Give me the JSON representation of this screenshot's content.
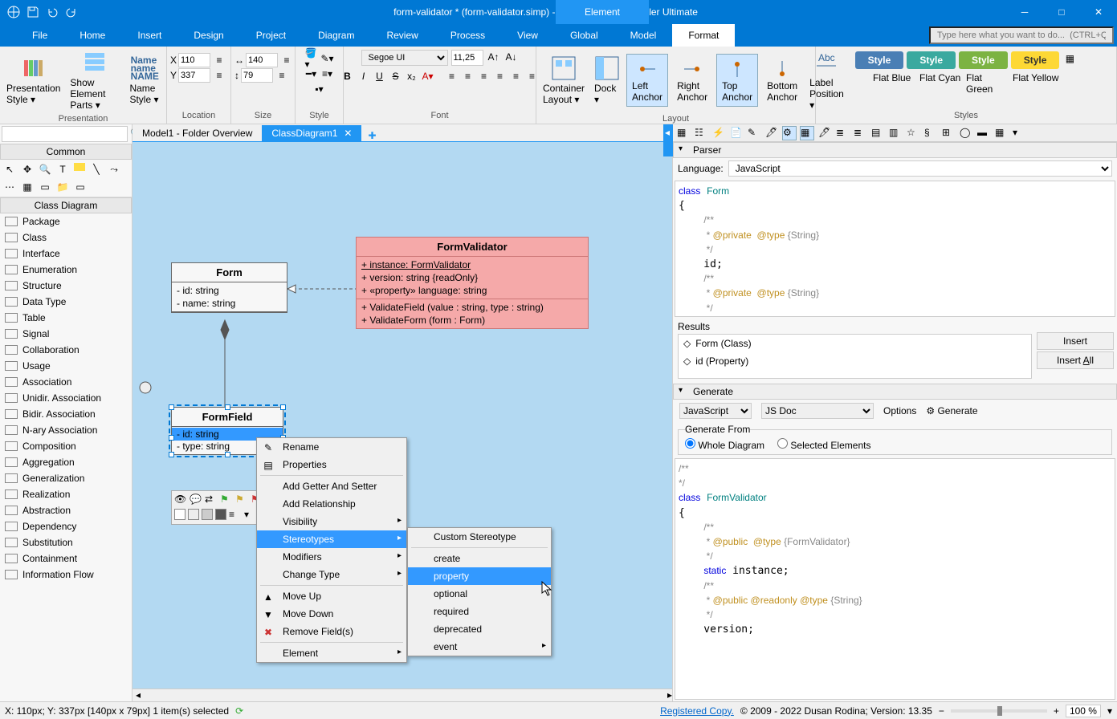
{
  "titlebar": {
    "title": "form-validator * (form-validator.simp) - Software Ideas Modeler Ultimate",
    "element_tab": "Element"
  },
  "menu": {
    "items": [
      "File",
      "Home",
      "Insert",
      "Design",
      "Project",
      "Diagram",
      "Review",
      "Process",
      "View",
      "Global",
      "Model",
      "Format"
    ],
    "active": 11,
    "search_placeholder": "Type here what you want to do...  (CTRL+Q)"
  },
  "ribbon": {
    "presentation": {
      "style": "Presentation Style ▾",
      "show": "Show Element Parts ▾",
      "name": "Name Style ▾",
      "label": "Presentation"
    },
    "location": {
      "x": "110",
      "y": "337",
      "label": "Location"
    },
    "size": {
      "w": "140",
      "h": "79",
      "label": "Size"
    },
    "style_label": "Style",
    "font": {
      "name": "Segoe UI",
      "size": "11,25",
      "bold": "B",
      "italic": "I",
      "underline": "U",
      "strike": "S",
      "label": "Font"
    },
    "layout": {
      "container": "Container Layout ▾",
      "dock": "Dock ▾",
      "left": "Left Anchor",
      "right": "Right Anchor",
      "top": "Top Anchor",
      "bottom": "Bottom Anchor",
      "labelpos": "Label Position ▾",
      "label": "Layout"
    },
    "styles": {
      "s1": "Style",
      "s2": "Style",
      "s3": "Style",
      "s4": "Style",
      "flat1": "Flat Blue",
      "flat2": "Flat Cyan",
      "flat3": "Flat Green",
      "flat4": "Flat Yellow",
      "label": "Styles"
    }
  },
  "tabs": {
    "t1": "Model1 - Folder Overview",
    "t2": "ClassDiagram1"
  },
  "left": {
    "common": "Common",
    "cd": "Class Diagram",
    "elements": [
      "Package",
      "Class",
      "Interface",
      "Enumeration",
      "Structure",
      "Data Type",
      "Table",
      "Signal",
      "Collaboration",
      "Usage",
      "Association",
      "Unidir. Association",
      "Bidir. Association",
      "N-ary Association",
      "Composition",
      "Aggregation",
      "Generalization",
      "Realization",
      "Abstraction",
      "Dependency",
      "Substitution",
      "Containment",
      "Information Flow"
    ]
  },
  "canvas": {
    "form": {
      "title": "Form",
      "a1": "- id: string",
      "a2": "- name: string"
    },
    "fv": {
      "title": "FormValidator",
      "r1": "+ instance: FormValidator",
      "r2": "+ version: string {readOnly}",
      "r3": "+ «property» language: string",
      "m1": "+ ValidateField (value : string, type : string)",
      "m2": "+ ValidateForm (form : Form)"
    },
    "ff": {
      "title": "FormField",
      "a1": "- id: string",
      "a2": "- type: string"
    }
  },
  "ctx1": {
    "rename": "Rename",
    "props": "Properties",
    "getter": "Add Getter And Setter",
    "rel": "Add Relationship",
    "vis": "Visibility",
    "stereo": "Stereotypes",
    "mod": "Modifiers",
    "ctype": "Change Type",
    "up": "Move Up",
    "down": "Move Down",
    "remove": "Remove Field(s)",
    "elem": "Element"
  },
  "ctx2": {
    "custom": "Custom Stereotype",
    "create": "create",
    "property": "property",
    "optional": "optional",
    "required": "required",
    "deprecated": "deprecated",
    "event": "event"
  },
  "parser": {
    "hdr": "Parser",
    "lang_lbl": "Language:",
    "lang": "JavaScript",
    "results_lbl": "Results",
    "r1": "Form (Class)",
    "r2": "id (Property)",
    "insert": "Insert",
    "insert_all": "Insert All"
  },
  "generate": {
    "hdr": "Generate",
    "lang": "JavaScript",
    "doc": "JS Doc",
    "opts": "Options",
    "gen": "Generate",
    "from": "Generate From",
    "whole": "Whole Diagram",
    "sel": "Selected Elements"
  },
  "status": {
    "pos": "X: 110px; Y: 337px   [140px x 79px] 1 item(s) selected",
    "reg": "Registered Copy.",
    "copy": "© 2009 - 2022 Dusan Rodina; Version: 13.35",
    "zoom": "100 %"
  }
}
